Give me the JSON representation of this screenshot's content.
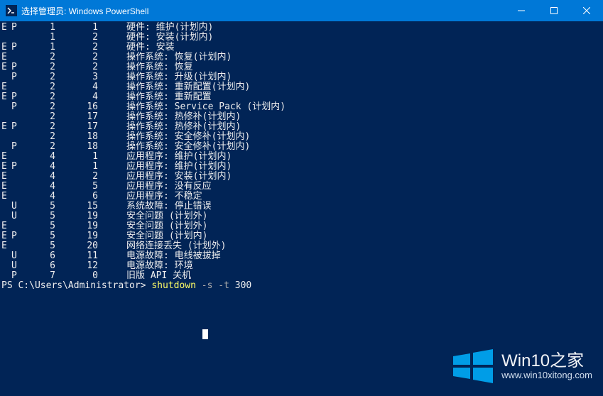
{
  "window": {
    "title": "选择管理员: Windows PowerShell"
  },
  "rows": [
    {
      "f": "E",
      "p": "P",
      "a": "1",
      "b": "1",
      "cat": "硬件:",
      "desc": "维护(计划内)"
    },
    {
      "f": "",
      "p": "",
      "a": "1",
      "b": "2",
      "cat": "硬件:",
      "desc": "安装(计划内)"
    },
    {
      "f": "E",
      "p": "P",
      "a": "1",
      "b": "2",
      "cat": "硬件:",
      "desc": "安装"
    },
    {
      "f": "E",
      "p": "",
      "a": "2",
      "b": "2",
      "cat": "操作系统:",
      "desc": "恢复(计划内)"
    },
    {
      "f": "E",
      "p": "P",
      "a": "2",
      "b": "2",
      "cat": "操作系统:",
      "desc": "恢复"
    },
    {
      "f": "",
      "p": "P",
      "a": "2",
      "b": "3",
      "cat": "操作系统:",
      "desc": "升级(计划内)"
    },
    {
      "f": "E",
      "p": "",
      "a": "2",
      "b": "4",
      "cat": "操作系统:",
      "desc": "重新配置(计划内)"
    },
    {
      "f": "E",
      "p": "P",
      "a": "2",
      "b": "4",
      "cat": "操作系统:",
      "desc": "重新配置"
    },
    {
      "f": "",
      "p": "P",
      "a": "2",
      "b": "16",
      "cat": "操作系统:",
      "desc": "Service Pack (计划内)"
    },
    {
      "f": "",
      "p": "",
      "a": "2",
      "b": "17",
      "cat": "操作系统:",
      "desc": "热修补(计划内)"
    },
    {
      "f": "E",
      "p": "P",
      "a": "2",
      "b": "17",
      "cat": "操作系统:",
      "desc": "热修补(计划内)"
    },
    {
      "f": "",
      "p": "",
      "a": "2",
      "b": "18",
      "cat": "操作系统:",
      "desc": "安全修补(计划内)"
    },
    {
      "f": "",
      "p": "P",
      "a": "2",
      "b": "18",
      "cat": "操作系统:",
      "desc": "安全修补(计划内)"
    },
    {
      "f": "E",
      "p": "",
      "a": "4",
      "b": "1",
      "cat": "应用程序:",
      "desc": "维护(计划内)"
    },
    {
      "f": "E",
      "p": "P",
      "a": "4",
      "b": "1",
      "cat": "应用程序:",
      "desc": "维护(计划内)"
    },
    {
      "f": "E",
      "p": "",
      "a": "4",
      "b": "2",
      "cat": "应用程序:",
      "desc": "安装(计划内)"
    },
    {
      "f": "E",
      "p": "",
      "a": "4",
      "b": "5",
      "cat": "应用程序:",
      "desc": "没有反应"
    },
    {
      "f": "E",
      "p": "",
      "a": "4",
      "b": "6",
      "cat": "应用程序:",
      "desc": "不稳定"
    },
    {
      "f": "",
      "p": "U",
      "a": "5",
      "b": "15",
      "cat": "系统故障:",
      "desc": "停止错误"
    },
    {
      "f": "",
      "p": "U",
      "a": "5",
      "b": "19",
      "cat": "安全问题",
      "desc": "(计划外)"
    },
    {
      "f": "E",
      "p": "",
      "a": "5",
      "b": "19",
      "cat": "安全问题",
      "desc": "(计划外)"
    },
    {
      "f": "E",
      "p": "P",
      "a": "5",
      "b": "19",
      "cat": "安全问题",
      "desc": "(计划内)"
    },
    {
      "f": "E",
      "p": "",
      "a": "5",
      "b": "20",
      "cat": "网络连接丢失",
      "desc": "(计划外)"
    },
    {
      "f": "",
      "p": "U",
      "a": "6",
      "b": "11",
      "cat": "电源故障:",
      "desc": "电线被拔掉"
    },
    {
      "f": "",
      "p": "U",
      "a": "6",
      "b": "12",
      "cat": "电源故障:",
      "desc": "环境"
    },
    {
      "f": "",
      "p": "P",
      "a": "7",
      "b": "0",
      "cat": "旧版 API",
      "desc": "关机"
    }
  ],
  "prompt": {
    "path": "PS C:\\Users\\Administrator>",
    "cmd": "shutdown",
    "args1": "-s -t",
    "args2": "300"
  },
  "watermark": {
    "title": "Win10之家",
    "url": "www.win10xitong.com"
  }
}
